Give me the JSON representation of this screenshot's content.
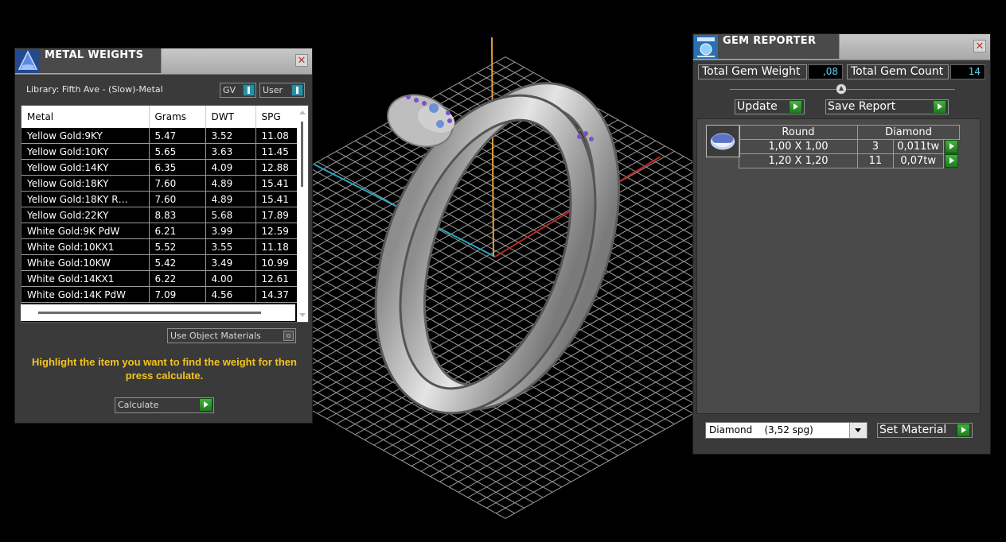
{
  "metal_weights": {
    "title": "METAL WEIGHTS",
    "close_label": "✕",
    "library_label": "Library: Fifth Ave - (Slow)-Metal",
    "dropdown_gv": "GV",
    "dropdown_user": "User",
    "columns": [
      "Metal",
      "Grams",
      "DWT",
      "SPG"
    ],
    "rows": [
      [
        "Yellow Gold:9KY",
        "5.47",
        "3.52",
        "11.08"
      ],
      [
        "Yellow Gold:10KY",
        "5.65",
        "3.63",
        "11.45"
      ],
      [
        "Yellow Gold:14KY",
        "6.35",
        "4.09",
        "12.88"
      ],
      [
        "Yellow Gold:18KY",
        "7.60",
        "4.89",
        "15.41"
      ],
      [
        "Yellow Gold:18KY R…",
        "7.60",
        "4.89",
        "15.41"
      ],
      [
        "Yellow Gold:22KY",
        "8.83",
        "5.68",
        "17.89"
      ],
      [
        "White Gold:9K PdW",
        "6.21",
        "3.99",
        "12.59"
      ],
      [
        "White Gold:10KX1",
        "5.52",
        "3.55",
        "11.18"
      ],
      [
        "White Gold:10KW",
        "5.42",
        "3.49",
        "10.99"
      ],
      [
        "White Gold:14KX1",
        "6.22",
        "4.00",
        "12.61"
      ],
      [
        "White Gold:14K PdW",
        "7.09",
        "4.56",
        "14.37"
      ]
    ],
    "use_object_materials": "Use Object Materials",
    "instruction": "Highlight the item you want to find the weight for then press calculate.",
    "calculate_label": "Calculate"
  },
  "gem_reporter": {
    "title": "GEM REPORTER",
    "close_label": "✕",
    "total_weight_label": "Total Gem Weight",
    "total_weight_value": ",08",
    "total_count_label": "Total Gem Count",
    "total_count_value": "14",
    "update_label": "Update",
    "save_report_label": "Save Report",
    "table_headers": [
      "Round",
      "Diamond"
    ],
    "gems": [
      {
        "size": "1,00 X 1,00",
        "count": "3",
        "weight": "0,011tw"
      },
      {
        "size": "1,20 X 1,20",
        "count": "11",
        "weight": "0,07tw"
      }
    ],
    "material_selected": "Diamond    (3,52 spg)",
    "set_material_label": "Set Material"
  },
  "colors": {
    "panel_bg": "#3a3a3a",
    "instruction_text": "#f3c41e",
    "value_text": "#5fd3f0",
    "accent_green": "#2e9e2e",
    "accent_teal": "#2a8fa5"
  }
}
